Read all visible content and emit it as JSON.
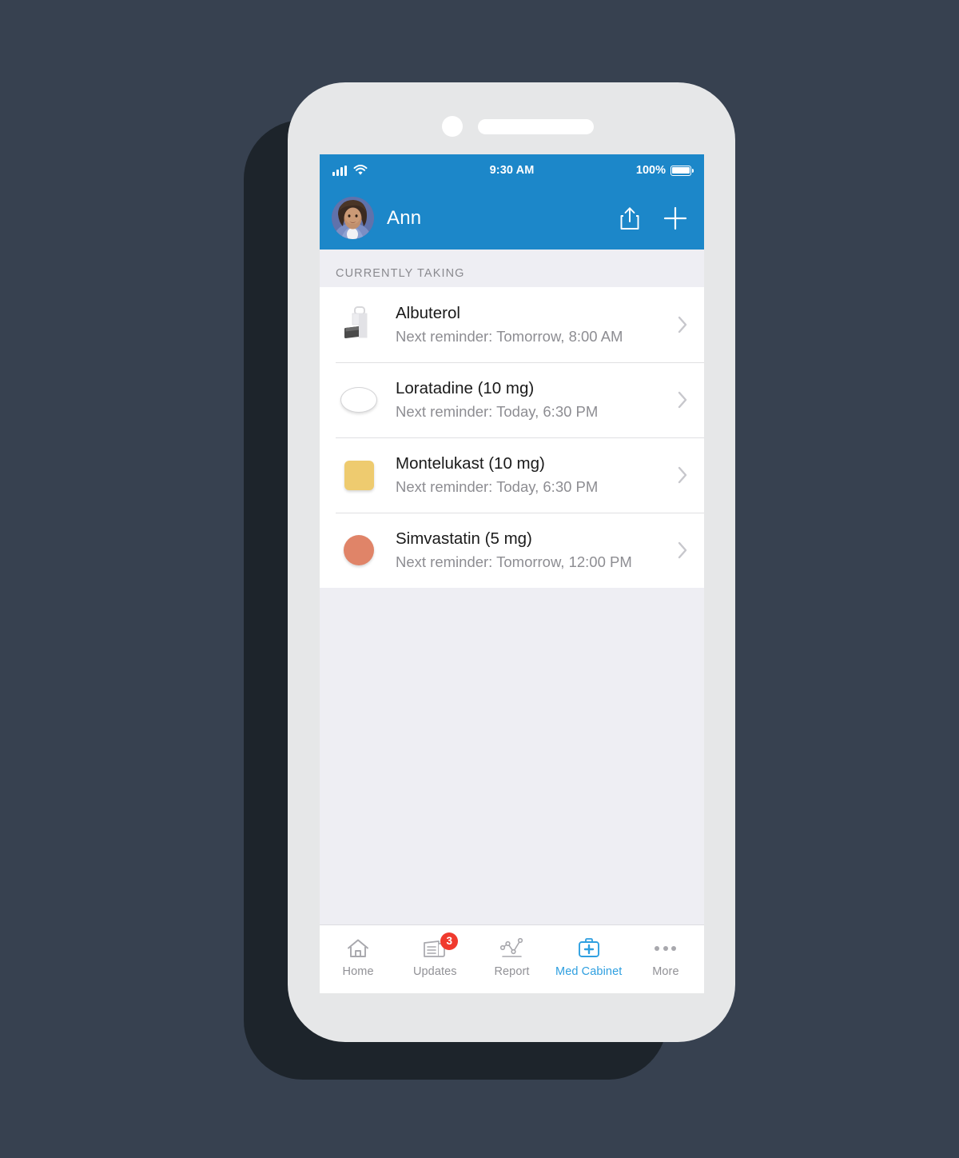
{
  "theme": {
    "background": "#374150",
    "phone_body": "#e6e7e8",
    "phone_shadow": "#1d242b",
    "header_blue": "#1c87c9",
    "accent_blue": "#2e9fe0",
    "badge_red": "#f03a2e",
    "section_bg": "#eeeef3",
    "text_primary": "#1a1a1a",
    "text_secondary": "#8d8d92"
  },
  "status_bar": {
    "signal_icon": "signal-bars-icon",
    "wifi_icon": "wifi-icon",
    "time": "9:30 AM",
    "battery_percent": "100%",
    "battery_icon": "battery-full-icon"
  },
  "header": {
    "avatar_icon": "user-avatar",
    "user_name": "Ann",
    "share_icon": "share-icon",
    "add_icon": "plus-icon"
  },
  "section": {
    "title": "CURRENTLY TAKING"
  },
  "medications": [
    {
      "name": "Albuterol",
      "reminder": "Next reminder: Tomorrow, 8:00 AM",
      "icon": "inhaler-icon",
      "shape": "inhaler",
      "color": "#e8e8ea",
      "chevron_icon": "chevron-right-icon"
    },
    {
      "name": "Loratadine (10 mg)",
      "reminder": "Next reminder: Today, 6:30 PM",
      "icon": "pill-oval-icon",
      "shape": "oval",
      "color": "#ffffff",
      "chevron_icon": "chevron-right-icon"
    },
    {
      "name": "Montelukast (10 mg)",
      "reminder": "Next reminder: Today, 6:30 PM",
      "icon": "pill-square-icon",
      "shape": "square",
      "color": "#eecb6f",
      "chevron_icon": "chevron-right-icon"
    },
    {
      "name": "Simvastatin (5 mg)",
      "reminder": "Next reminder: Tomorrow, 12:00 PM",
      "icon": "pill-circle-icon",
      "shape": "circle",
      "color": "#e08468",
      "chevron_icon": "chevron-right-icon"
    }
  ],
  "tabs": [
    {
      "label": "Home",
      "icon": "home-icon",
      "active": false,
      "badge": null
    },
    {
      "label": "Updates",
      "icon": "news-icon",
      "active": false,
      "badge": "3"
    },
    {
      "label": "Report",
      "icon": "line-chart-icon",
      "active": false,
      "badge": null
    },
    {
      "label": "Med Cabinet",
      "icon": "medkit-icon",
      "active": true,
      "badge": null
    },
    {
      "label": "More",
      "icon": "ellipsis-icon",
      "active": false,
      "badge": null
    }
  ]
}
